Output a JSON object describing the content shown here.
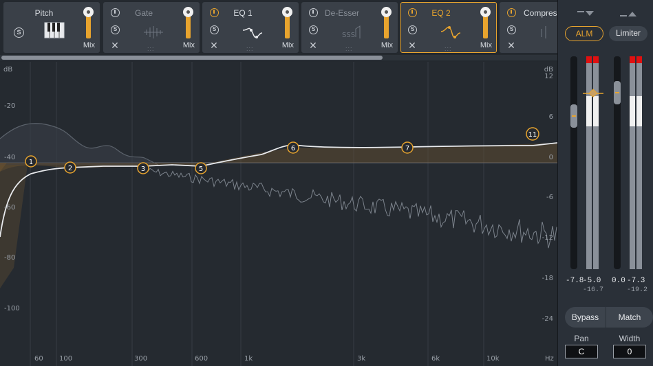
{
  "modules": [
    {
      "name": "Pitch",
      "mix": "Mix",
      "state": "normal"
    },
    {
      "name": "Gate",
      "mix": "Mix",
      "state": "dim"
    },
    {
      "name": "EQ 1",
      "mix": "Mix",
      "state": "normal"
    },
    {
      "name": "De-Esser",
      "mix": "Mix",
      "state": "dim"
    },
    {
      "name": "EQ 2",
      "mix": "Mix",
      "state": "selected"
    },
    {
      "name": "Compres",
      "mix": "",
      "state": "normal"
    }
  ],
  "eq": {
    "left_axis": {
      "unit": "dB",
      "ticks": [
        "-20",
        "-40",
        "-60",
        "-80",
        "-100"
      ]
    },
    "right_axis": {
      "unit": "dB",
      "ticks": [
        "12",
        "6",
        "0",
        "-6",
        "-12",
        "-18",
        "-24"
      ]
    },
    "freq_axis": {
      "unit": "Hz",
      "ticks": [
        "60",
        "100",
        "300",
        "600",
        "1k",
        "3k",
        "6k",
        "10k"
      ]
    },
    "nodes": [
      "1",
      "2",
      "3",
      "5",
      "6",
      "7",
      "11"
    ]
  },
  "right_panel": {
    "alm_label": "ALM",
    "limiter_label": "Limiter",
    "input": {
      "gain": "-7.8",
      "peak": "-5.0",
      "rms": "-16.7"
    },
    "output": {
      "gain": "0.0",
      "peak": "-7.3",
      "rms": "-19.2"
    },
    "bypass_label": "Bypass",
    "match_label": "Match",
    "pan_label": "Pan",
    "pan_value": "C",
    "width_label": "Width",
    "width_value": "0"
  },
  "colors": {
    "accent": "#e8a42e",
    "clip": "#e01010"
  }
}
